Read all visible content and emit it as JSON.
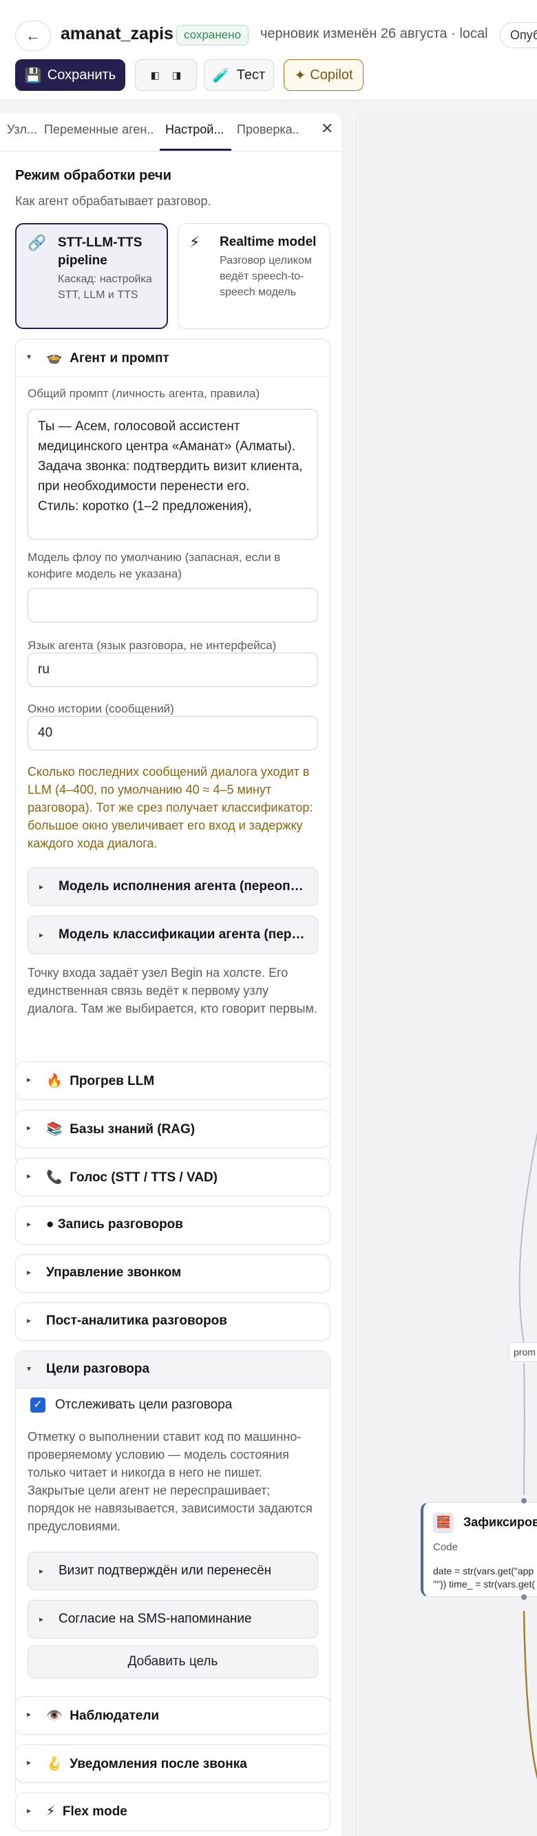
{
  "header": {
    "back": "←",
    "title": "amanat_zapis",
    "status": "сохранено",
    "draft_info": "черновик изменён 26 августа · local",
    "publish": "Опубликовать"
  },
  "toolbar": {
    "save_icon": "💾",
    "save": "Сохранить",
    "layout_left": "◧",
    "layout_right": "◨",
    "test_icon": "🧪",
    "test": "Тест",
    "copilot_icon": "✦",
    "copilot": "Copilot"
  },
  "tabs": [
    {
      "label": "Узл...",
      "active": false
    },
    {
      "label": "Переменные аген...",
      "active": false
    },
    {
      "label": "Настрой...",
      "active": true
    },
    {
      "label": "Проверка...",
      "active": false
    }
  ],
  "close": "✕",
  "speech_mode": {
    "title": "Режим обработки речи",
    "description": "Как агент обрабатывает разговор.",
    "options": [
      {
        "icon": "🔗",
        "title": "STT-LLM-TTS pipeline",
        "subtitle": "Каскад: настройка STT, LLM и TTS",
        "selected": true
      },
      {
        "icon": "⚡",
        "title": "Realtime model",
        "subtitle": "Разговор целиком ведёт speech-to-speech модель",
        "selected": false
      }
    ]
  },
  "agent_prompt": {
    "icon": "🍲",
    "title": "Агент и промпт",
    "prompt_label": "Общий промпт (личность агента, правила)",
    "prompt_value": "Ты — Асем, голосовой ассистент медицинского центра «Аманат» (Алматы).\nЗадача звонка: подтвердить визит клиента, при необходимости перенести его.\nСтиль: коротко (1–2 предложения),",
    "flow_model_label": "Модель флоу по умолчанию (запасная, если в конфиге модель не указана)",
    "flow_model_value": "",
    "language_label": "Язык агента (язык разговора, не интерфейса)",
    "language_value": "ru",
    "history_label": "Окно истории (сообщений)",
    "history_value": "40",
    "history_help": "Сколько последних сообщений диалога уходит в LLM (4–400, по умолчанию 40 ≈ 4–5 минут разговора). Тот же срез получает классификатор: большое окно увеличивает его вход и задержку каждого хода диалога.",
    "exec_model": "Модель исполнения агента (переопределение)",
    "class_model": "Модель классификации агента (переопределение)",
    "entry_help": "Точку входа задаёт узел Begin на холсте. Его единственная связь ведёт к первому узлу диалога. Там же выбирается, кто говорит первым."
  },
  "sections": [
    {
      "icon": "🔥",
      "label": "Прогрев LLM"
    },
    {
      "icon": "📚",
      "label": "Базы знаний (RAG)"
    },
    {
      "icon": "📞",
      "label": "Голос (STT / TTS / VAD)"
    },
    {
      "icon": "●",
      "label": "Запись разговоров"
    },
    {
      "icon": "",
      "label": "Управление звонком"
    },
    {
      "icon": "",
      "label": "Пост-аналитика разговоров"
    }
  ],
  "goals": {
    "title": "Цели разговора",
    "track_label": "Отслеживать цели разговора",
    "track_checked": true,
    "check_mark": "✓",
    "help": "Отметку о выполнении ставит код по машинно-проверяемому условию — модель состояния только читает и никогда в него не пишет. Закрытые цели агент не переспрашивает; порядок не навязывается, зависимости задаются предусловиями.",
    "items": [
      "Визит подтверждён или перенесён",
      "Согласие на SMS-напоминание"
    ],
    "add": "Добавить цель"
  },
  "sections_bottom": [
    {
      "icon": "👁️",
      "label": "Наблюдатели"
    },
    {
      "icon": "🪝",
      "label": "Уведомления после звонка"
    },
    {
      "icon": "⚡",
      "label": "Flex mode"
    }
  ],
  "chevron_right": "▸",
  "chevron_down": "▾",
  "canvas": {
    "edge_label": "prom",
    "node": {
      "icon": "🧱",
      "title": "Зафиксировать",
      "type": "Code",
      "code_line1": "date = str(vars.get(\"app",
      "code_line2": "\"\")) time_ = str(vars.get("
    }
  },
  "colors": {
    "brand": "#25204f",
    "saved": "#2f8a57",
    "copilot": "#a3791e",
    "help_amber": "#8a6514",
    "checkbox": "#1e63d6"
  }
}
